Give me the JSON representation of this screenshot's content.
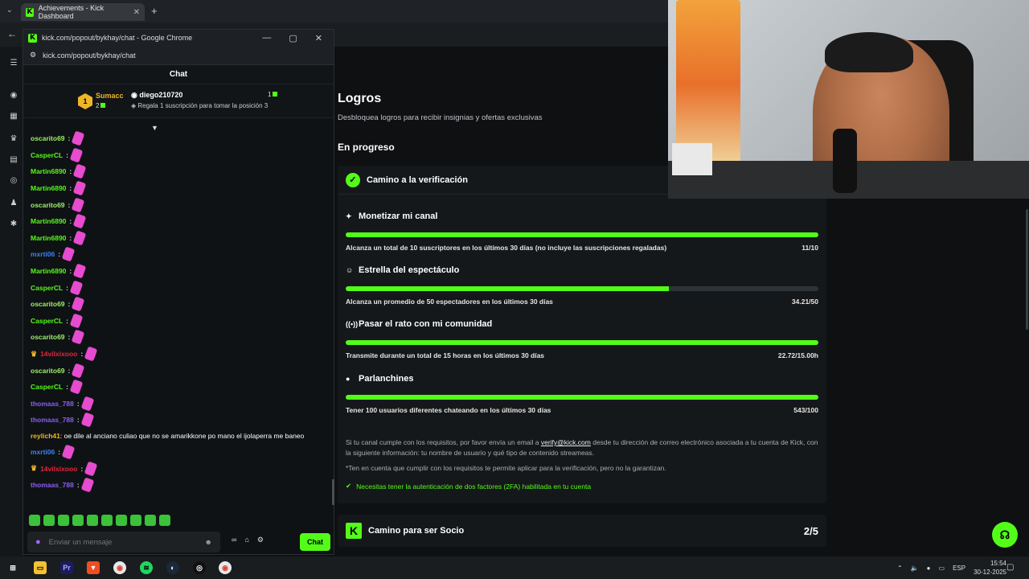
{
  "browser": {
    "tab_title": "Achievements - Kick Dashboard",
    "tab_close": "✕",
    "new_tab": "+",
    "tab_list": "⌄",
    "back": "←"
  },
  "popup": {
    "window_title": "kick.com/popout/bykhay/chat - Google Chrome",
    "url": "kick.com/popout/bykhay/chat",
    "min": "—",
    "max": "▢",
    "close": "✕"
  },
  "chat": {
    "header": "Chat",
    "pinned": {
      "rank": "1",
      "top_user": "Sumacc",
      "top_count": "2",
      "second_user": "diego210720",
      "second_count": "1",
      "note": "Regala 1 suscripción para tomar la posición 3"
    },
    "messages": [
      {
        "user": "oscarito69",
        "color": "#9cf06a"
      },
      {
        "user": "CasperCL",
        "color": "#53fc18"
      },
      {
        "user": "Martin6890",
        "color": "#53fc18"
      },
      {
        "user": "Martin6890",
        "color": "#53fc18"
      },
      {
        "user": "oscarito69",
        "color": "#9cf06a"
      },
      {
        "user": "Martin6890",
        "color": "#53fc18"
      },
      {
        "user": "Martin6890",
        "color": "#53fc18"
      },
      {
        "user": "mxrti06",
        "color": "#3b82f6"
      },
      {
        "user": "Martin6890",
        "color": "#53fc18"
      },
      {
        "user": "CasperCL",
        "color": "#53fc18"
      },
      {
        "user": "oscarito69",
        "color": "#9cf06a"
      },
      {
        "user": "CasperCL",
        "color": "#53fc18"
      },
      {
        "user": "oscarito69",
        "color": "#9cf06a"
      },
      {
        "user": "14vilxixooo",
        "color": "#e0263c",
        "crown": true
      },
      {
        "user": "oscarito69",
        "color": "#9cf06a"
      },
      {
        "user": "CasperCL",
        "color": "#53fc18"
      },
      {
        "user": "thomaas_788",
        "color": "#8b5cf6"
      },
      {
        "user": "thomaas_788",
        "color": "#8b5cf6"
      }
    ],
    "long_message": {
      "user": "reylich41",
      "text": "oe dile al anciano culiao que no se amarikkone po mano el ijolaperra me baneo"
    },
    "tail_messages": [
      {
        "user": "mxrti06",
        "color": "#3b82f6"
      },
      {
        "user": "14vilxixooo",
        "color": "#e0263c",
        "crown": true
      },
      {
        "user": "thomaas_788",
        "color": "#8b5cf6"
      }
    ],
    "input_placeholder": "Enviar un mensaje",
    "send_label": "Chat"
  },
  "sidebar_icons": [
    "broadcast-icon",
    "analytics-icon",
    "trophy-icon",
    "community-icon",
    "moderation-icon",
    "users-icon",
    "settings-icon"
  ],
  "achievements": {
    "title": "Logros",
    "subtitle": "Desbloquea logros para recibir insignias y ofertas exclusivas",
    "section": "En progreso",
    "verification": {
      "title": "Camino a la verificación",
      "goals": [
        {
          "title": "Monetizar mi canal",
          "icon": "✦",
          "desc": "Alcanza un total de 10 suscriptores en los últimos 30 días (no incluye las suscripciones regaladas)",
          "progress": "11/10",
          "fill": 1.0
        },
        {
          "title": "Estrella del espectáculo",
          "icon": "☺",
          "desc": "Alcanza un promedio de 50 espectadores en los últimos 30 días",
          "progress": "34.21/50",
          "fill": 0.684
        },
        {
          "title": "Pasar el rato con mi comunidad",
          "icon": "((•))",
          "desc": "Transmite durante un total de 15 horas en los últimos 30 días",
          "progress": "22.72/15.00h",
          "fill": 1.0
        },
        {
          "title": "Parlanchines",
          "icon": "●",
          "desc": "Tener 100 usuarios diferentes chateando en los últimos 30 días",
          "progress": "543/100",
          "fill": 1.0
        }
      ],
      "info_pre": "Si tu canal cumple con los requisitos, por favor envía un email a ",
      "info_email": "verify@kick.com",
      "info_post": " desde tu dirección de correo electrónico asociada a tu cuenta de Kick, con la siguiente información: tu nombre de usuario y qué tipo de contenido streameas.",
      "note": "*Ten en cuenta que cumplir con los requisitos te permite aplicar para la verificación, pero no la garantizan.",
      "twofa": "Necesitas tener la autenticación de dos factores (2FA) habilitada en tu cuenta"
    },
    "partner": {
      "title": "Camino para ser Socio",
      "count": "2/5"
    }
  },
  "taskbar": {
    "lang": "ESP",
    "time": "15:54",
    "date": "30-12-2025"
  },
  "colors": {
    "accent": "#53fc18",
    "background": "#0e1012"
  }
}
